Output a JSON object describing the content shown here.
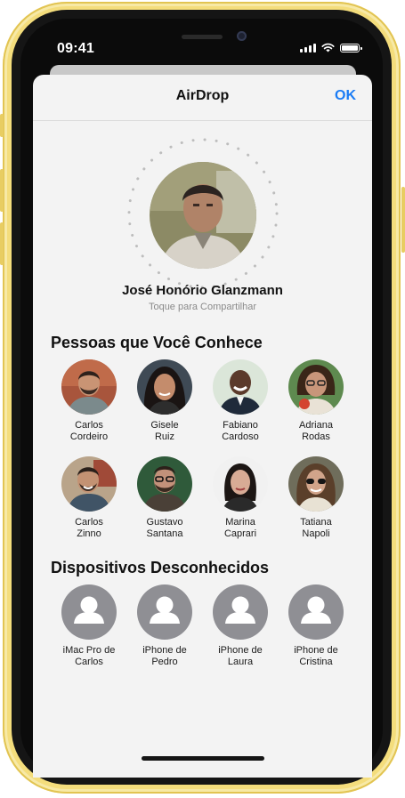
{
  "status_bar": {
    "time": "09:41"
  },
  "sheet": {
    "title": "AirDrop",
    "done_label": "OK",
    "me": {
      "name": "José Honório Glanzmann",
      "subtitle": "Toque para Compartilhar"
    }
  },
  "people_section": {
    "title": "Pessoas que Você Conhece",
    "people": [
      {
        "first": "Carlos",
        "last": "Cordeiro"
      },
      {
        "first": "Gisele",
        "last": "Ruiz"
      },
      {
        "first": "Fabiano",
        "last": "Cardoso"
      },
      {
        "first": "Adriana",
        "last": "Rodas"
      },
      {
        "first": "Carlos",
        "last": "Zinno"
      },
      {
        "first": "Gustavo",
        "last": "Santana"
      },
      {
        "first": "Marina",
        "last": "Caprari"
      },
      {
        "first": "Tatiana",
        "last": "Napoli"
      }
    ]
  },
  "devices_section": {
    "title": "Dispositivos Desconhecidos",
    "devices": [
      {
        "line1": "iMac Pro de",
        "line2": "Carlos"
      },
      {
        "line1": "iPhone de",
        "line2": "Pedro"
      },
      {
        "line1": "iPhone de",
        "line2": "Laura"
      },
      {
        "line1": "iPhone de",
        "line2": "Cristina"
      }
    ]
  },
  "colors": {
    "accent": "#1a7cf5",
    "frame": "#f4dd7c",
    "device_avatar": "#8f8f94"
  }
}
